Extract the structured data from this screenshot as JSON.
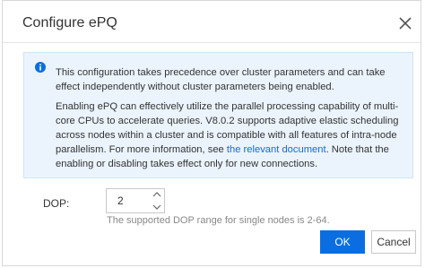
{
  "dialog": {
    "title": "Configure ePQ"
  },
  "notice": {
    "paragraph1": "This configuration takes precedence over cluster parameters and can take effect independently without cluster parameters being enabled.",
    "paragraph2_before_link": "Enabling ePQ can effectively utilize the parallel processing capability of multi-core CPUs to accelerate queries. V8.0.2 supports adaptive elastic scheduling across nodes within a cluster and is compatible with all features of intra-node parallelism. For more information, see ",
    "link_text": "the relevant document",
    "paragraph2_after_link": ". Note that the enabling or disabling takes effect only for new connections."
  },
  "form": {
    "dop_label": "DOP:",
    "dop_value": "2",
    "dop_hint": "The supported DOP range for single nodes is 2-64."
  },
  "buttons": {
    "ok": "OK",
    "cancel": "Cancel"
  },
  "colors": {
    "primary": "#0a6ee0",
    "notice_bg": "#ebf4fd",
    "text": "#333333",
    "hint": "#888888"
  },
  "icons": {
    "close": "close-icon",
    "info": "info-icon",
    "up": "chevron-up-icon",
    "down": "chevron-down-icon"
  }
}
